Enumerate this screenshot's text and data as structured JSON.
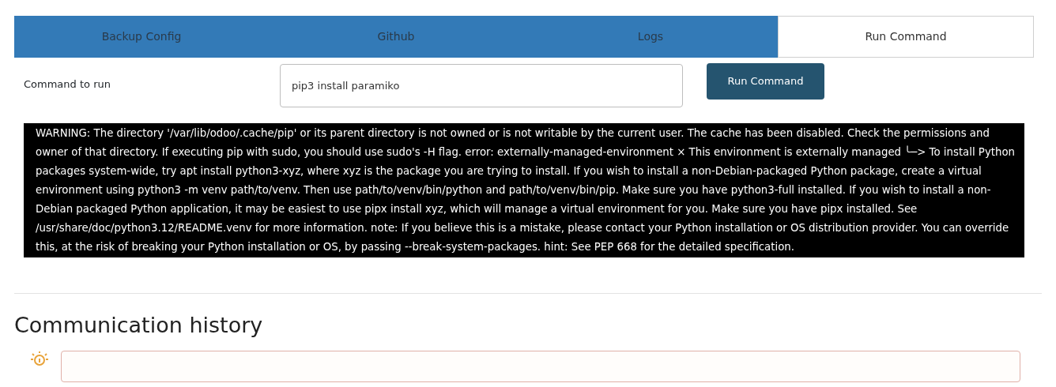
{
  "tabs": [
    {
      "label": "Backup Config",
      "selected": false
    },
    {
      "label": "Github",
      "selected": false
    },
    {
      "label": "Logs",
      "selected": false
    },
    {
      "label": "Run Command",
      "selected": true
    }
  ],
  "command_form": {
    "label": "Command to run",
    "value": "pip3 install paramiko",
    "button": "Run Command"
  },
  "output": "WARNING: The directory '/var/lib/odoo/.cache/pip' or its parent directory is not owned or is not writable by the current user. The cache has been disabled. Check the permissions and owner of that directory. If executing pip with sudo, you should use sudo's -H flag. error: externally-managed-environment × This environment is externally managed ╰─> To install Python packages system-wide, try apt install python3-xyz, where xyz is the package you are trying to install. If you wish to install a non-Debian-packaged Python package, create a virtual environment using python3 -m venv path/to/venv. Then use path/to/venv/bin/python and path/to/venv/bin/pip. Make sure you have python3-full installed. If you wish to install a non-Debian packaged Python application, it may be easiest to use pipx install xyz, which will manage a virtual environment for you. Make sure you have pipx installed. See /usr/share/doc/python3.12/README.venv for more information. note: If you believe this is a mistake, please contact your Python installation or OS distribution provider. You can override this, at the risk of breaking your Python installation or OS, by passing --break-system-packages. hint: See PEP 668 for the detailed specification.",
  "communication_history": {
    "title": "Communication history"
  }
}
